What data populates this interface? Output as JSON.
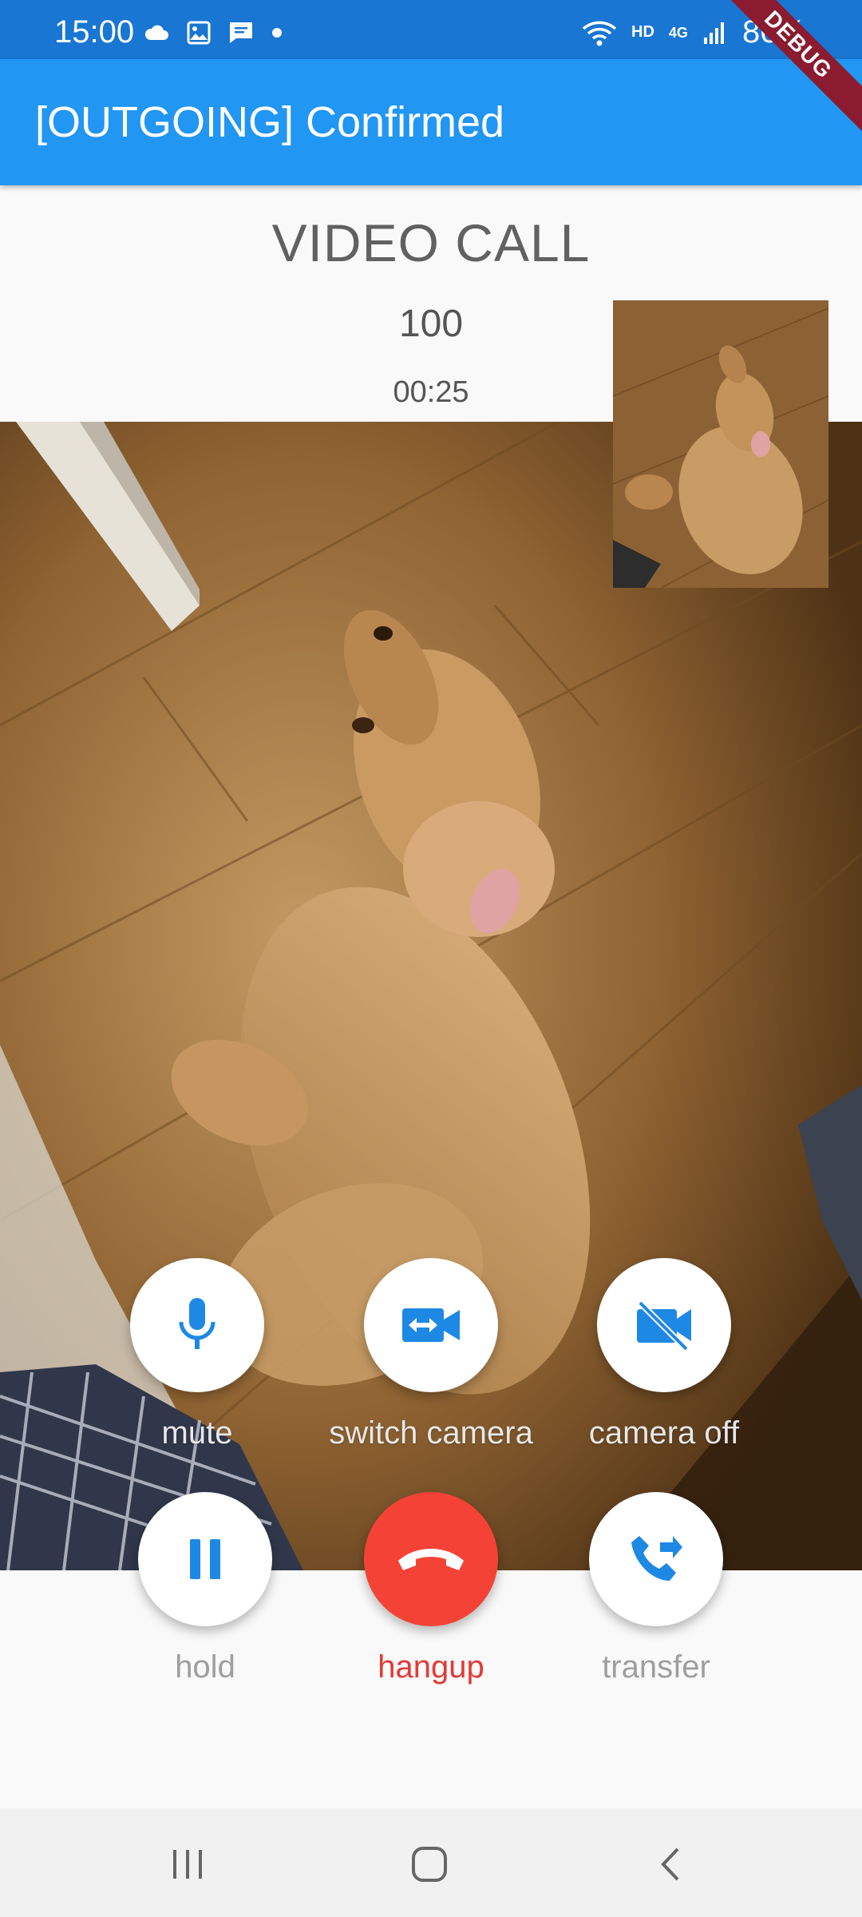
{
  "status_bar": {
    "time": "15:00",
    "network_badge": "HD",
    "network_type": "4G",
    "battery": "86%",
    "debug_banner": "DEBUG",
    "left_icons": [
      "cloud-icon",
      "image-icon",
      "message-icon",
      "dot-icon"
    ],
    "right_icons": [
      "wifi-icon",
      "signal-icon"
    ]
  },
  "app_bar": {
    "title": "[OUTGOING] Confirmed"
  },
  "call": {
    "type": "VIDEO CALL",
    "remote_party": "100",
    "duration": "00:25"
  },
  "controls": {
    "row1": [
      {
        "label": "mute",
        "icon": "microphone-icon"
      },
      {
        "label": "switch camera",
        "icon": "switch-camera-icon"
      },
      {
        "label": "camera off",
        "icon": "camera-off-icon"
      }
    ],
    "row2": [
      {
        "label": "hold",
        "icon": "pause-icon"
      },
      {
        "label": "hangup",
        "icon": "hangup-icon"
      },
      {
        "label": "transfer",
        "icon": "phone-forward-icon"
      }
    ]
  },
  "colors": {
    "accent": "#2196f3",
    "status_bar": "#1976d2",
    "hangup": "#f44336",
    "debug": "#8b1b2f"
  },
  "navigation": [
    "recent-apps-icon",
    "home-icon",
    "back-icon"
  ]
}
